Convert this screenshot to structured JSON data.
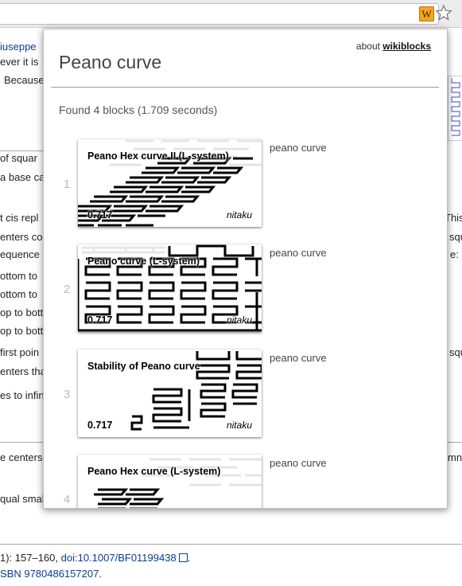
{
  "extension_icon_glyph": "W",
  "background_text": {
    "lines_top": [
      "iuseppe",
      "ever it is",
      "Because"
    ],
    "lines_mid": [
      "of squar",
      "a base ca",
      "t",
      "c",
      "is repl",
      "enters con",
      "equence",
      "ottom to",
      "ottom to",
      "op to botto",
      "op to botto",
      "first poin",
      "enters tha",
      "es to infin"
    ],
    "lines_right": [
      "This",
      "squ",
      "e:",
      "squ"
    ],
    "line_centers": "e centers",
    "line_mn": "mn",
    "line_equal": "qual smal",
    "ref1_prefix": "1): 157–160,",
    "ref1_link": "doi:10.1007/BF01199438",
    "ref1_suffix": ".",
    "ref2_link": "SBN 9780486157207",
    "ref2_suffix": "."
  },
  "popup": {
    "about_prefix": "about",
    "about_link": "wikiblocks",
    "title": "Peano curve",
    "found_text": "Found 4 blocks (1.709 seconds)",
    "results": [
      {
        "rank": "1",
        "title": "Peano Hex curve II (L-system)",
        "score": "0.717",
        "author": "nitaku",
        "description": "peano curve"
      },
      {
        "rank": "2",
        "title": "Peano curve (L-system)",
        "score": "0.717",
        "author": "nitaku",
        "description": "peano curve"
      },
      {
        "rank": "3",
        "title": "Stability of Peano curve",
        "score": "0.717",
        "author": "nitaku",
        "description": "peano curve"
      },
      {
        "rank": "4",
        "title": "Peano Hex curve (L-system)",
        "score": "",
        "author": "",
        "description": "peano curve"
      }
    ]
  }
}
